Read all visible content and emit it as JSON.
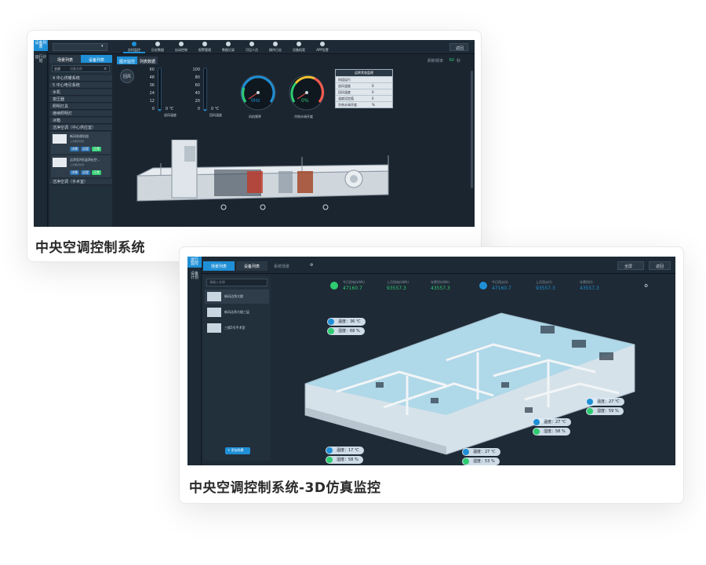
{
  "card1": {
    "caption": "中央空调控制系统",
    "left_nav": [
      "设备列表",
      "运行计划"
    ],
    "top_tabs": [
      "实时监控",
      "历史数据",
      "自动控制",
      "报警管理",
      "数据记录",
      "可见人员",
      "操作日志",
      "设备档案",
      "APP设置"
    ],
    "back_label": "返回",
    "side_tabs": [
      "场景列表",
      "设备列表"
    ],
    "search_placeholder": "设备名称",
    "search_filter": "全部",
    "device_groups": [
      "4 中心供暖系统",
      "5 中心电引系统",
      "水机",
      "变压器",
      "照明灯具",
      "继续照明灯",
      "冰箱",
      "洁净空调（中心供应室）"
    ],
    "devices": [
      {
        "name": "新风处理机组",
        "sub": "上次保养时间",
        "btns": [
          "详情",
          "远程",
          "正常"
        ]
      },
      {
        "name": "洁净型X恒温净化空...",
        "sub": "上次保养时间",
        "btns": [
          "详情",
          "远程",
          "正常"
        ]
      }
    ],
    "device_group_last": "洁净空调（手术室）",
    "sub_tabs": [
      "图示监控",
      "列表数据"
    ],
    "refresh_label": "刷新频率",
    "refresh_value": "60",
    "refresh_unit": "秒",
    "side_button": "回风",
    "thermo1": {
      "ticks": [
        "60",
        "48",
        "36",
        "24",
        "12",
        "0"
      ],
      "value": "0 ℃",
      "label": "送风温度",
      "fill": 0.0
    },
    "thermo2": {
      "ticks": [
        "100",
        "80",
        "60",
        "40",
        "20",
        "0"
      ],
      "value": "0 ℃",
      "label": "回风温度",
      "fill": 0.0
    },
    "gauge1": {
      "value": "0Hz",
      "label": "风机频率"
    },
    "gauge2": {
      "value": "0%",
      "label": "冷热水阀开度"
    },
    "status_table": {
      "title": "运转状态监视",
      "rows": [
        [
          "机组运行",
          ""
        ],
        [
          "送风温度",
          "0"
        ],
        [
          "回风湿度",
          "0"
        ],
        [
          "温度设定值",
          "0"
        ],
        [
          "冷热水阀开度",
          "%"
        ]
      ]
    }
  },
  "card2": {
    "caption": "中央空调控制系统-3D仿真监控",
    "left_nav": [
      "运行",
      "监控",
      "设备",
      "计划"
    ],
    "tabs": [
      "场景列表",
      "设备列表"
    ],
    "tab_extra": "系统场景",
    "search_placeholder": "请输入名称",
    "scenes": [
      "新风洁净大楼",
      "新风洁净大楼三层",
      "三楼5号手术室"
    ],
    "add_button": "+ 添加场景",
    "view_btn": "全屏",
    "back_label": "返回",
    "stats": [
      {
        "label": "今日用电(kWh)",
        "value": "47160.7"
      },
      {
        "label": "上月用电(kWh)",
        "value": "93557.3"
      },
      {
        "label": "年累积(kWh)",
        "value": "43557.3"
      },
      {
        "label": "今日用水(t)",
        "value": "47160.7"
      },
      {
        "label": "上月用水(t)",
        "value": "93557.3"
      },
      {
        "label": "年累积(t)",
        "value": "43557.3"
      }
    ],
    "sensors": [
      {
        "temp": "温度：36 ℃",
        "hum": "湿度：68 %"
      },
      {
        "temp": "温度：27 ℃",
        "hum": "湿度：59 %"
      },
      {
        "temp": "温度：27 ℃",
        "hum": "湿度：58 %"
      },
      {
        "temp": "温度：17 ℃",
        "hum": "湿度：58 %"
      },
      {
        "temp": "温度：27 ℃",
        "hum": "湿度：53 %"
      }
    ]
  },
  "colors": {
    "accent": "#1f8fd6",
    "green": "#2ecc71",
    "red": "#ff5a4f",
    "panel": "#1b2530"
  }
}
